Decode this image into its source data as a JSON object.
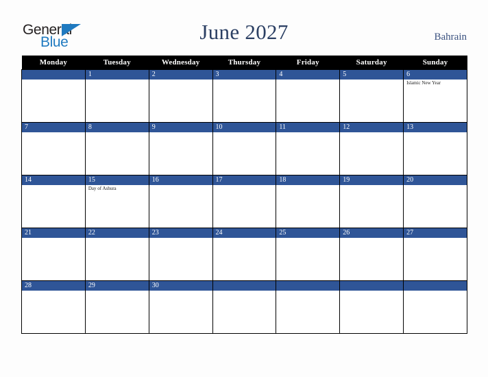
{
  "brand": {
    "name_part1": "General",
    "name_part2": "Blue",
    "accent_color": "#1f7ac0",
    "text_color": "#231f20"
  },
  "header": {
    "title": "June 2027",
    "country": "Bahrain",
    "title_color": "#2b3f63",
    "country_color": "#3b5280"
  },
  "calendar": {
    "weekday_headers": [
      "Monday",
      "Tuesday",
      "Wednesday",
      "Thursday",
      "Friday",
      "Saturday",
      "Sunday"
    ],
    "header_background": "#000000",
    "header_text_color": "#ffffff",
    "date_band_color": "#2f5597",
    "date_text_color": "#ffffff",
    "cell_background": "#ffffff",
    "grid_line_color": "#000000",
    "weeks": [
      [
        {
          "date": "",
          "events": []
        },
        {
          "date": "1",
          "events": []
        },
        {
          "date": "2",
          "events": []
        },
        {
          "date": "3",
          "events": []
        },
        {
          "date": "4",
          "events": []
        },
        {
          "date": "5",
          "events": []
        },
        {
          "date": "6",
          "events": [
            "Islamic New Year"
          ]
        }
      ],
      [
        {
          "date": "7",
          "events": []
        },
        {
          "date": "8",
          "events": []
        },
        {
          "date": "9",
          "events": []
        },
        {
          "date": "10",
          "events": []
        },
        {
          "date": "11",
          "events": []
        },
        {
          "date": "12",
          "events": []
        },
        {
          "date": "13",
          "events": []
        }
      ],
      [
        {
          "date": "14",
          "events": []
        },
        {
          "date": "15",
          "events": [
            "Day of Ashura"
          ]
        },
        {
          "date": "16",
          "events": []
        },
        {
          "date": "17",
          "events": []
        },
        {
          "date": "18",
          "events": []
        },
        {
          "date": "19",
          "events": []
        },
        {
          "date": "20",
          "events": []
        }
      ],
      [
        {
          "date": "21",
          "events": []
        },
        {
          "date": "22",
          "events": []
        },
        {
          "date": "23",
          "events": []
        },
        {
          "date": "24",
          "events": []
        },
        {
          "date": "25",
          "events": []
        },
        {
          "date": "26",
          "events": []
        },
        {
          "date": "27",
          "events": []
        }
      ],
      [
        {
          "date": "28",
          "events": []
        },
        {
          "date": "29",
          "events": []
        },
        {
          "date": "30",
          "events": []
        },
        {
          "date": "",
          "events": []
        },
        {
          "date": "",
          "events": []
        },
        {
          "date": "",
          "events": []
        },
        {
          "date": "",
          "events": []
        }
      ]
    ]
  }
}
